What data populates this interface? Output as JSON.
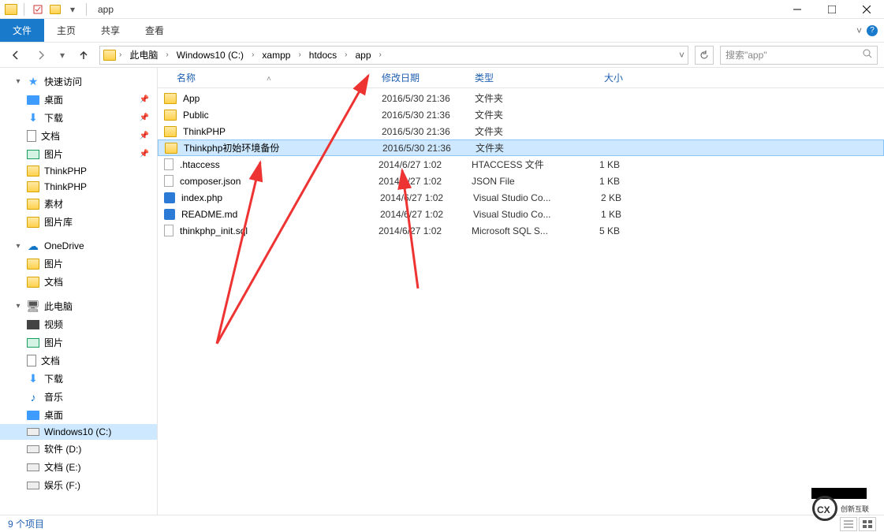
{
  "title": "app",
  "ribbon": {
    "file": "文件",
    "tabs": [
      "主页",
      "共享",
      "查看"
    ]
  },
  "breadcrumbs": [
    "此电脑",
    "Windows10 (C:)",
    "xampp",
    "htdocs",
    "app"
  ],
  "search_placeholder": "搜索\"app\"",
  "status_text": "9 个项目",
  "columns": {
    "name": "名称",
    "date": "修改日期",
    "type": "类型",
    "size": "大小"
  },
  "sidebar": {
    "quick": {
      "label": "快速访问",
      "items": [
        {
          "label": "桌面",
          "ico": "desktop",
          "pin": true
        },
        {
          "label": "下载",
          "ico": "download",
          "pin": true
        },
        {
          "label": "文档",
          "ico": "doc",
          "pin": true
        },
        {
          "label": "图片",
          "ico": "pic",
          "pin": true
        },
        {
          "label": "ThinkPHP",
          "ico": "folder"
        },
        {
          "label": "ThinkPHP",
          "ico": "folder"
        },
        {
          "label": "素材",
          "ico": "folder"
        },
        {
          "label": "图片库",
          "ico": "folder"
        }
      ]
    },
    "onedrive": {
      "label": "OneDrive",
      "items": [
        {
          "label": "图片",
          "ico": "folder"
        },
        {
          "label": "文档",
          "ico": "folder"
        }
      ]
    },
    "pc": {
      "label": "此电脑",
      "items": [
        {
          "label": "视频",
          "ico": "video"
        },
        {
          "label": "图片",
          "ico": "pic"
        },
        {
          "label": "文档",
          "ico": "doc"
        },
        {
          "label": "下载",
          "ico": "download"
        },
        {
          "label": "音乐",
          "ico": "music"
        },
        {
          "label": "桌面",
          "ico": "desktop"
        },
        {
          "label": "Windows10 (C:)",
          "ico": "drive",
          "selected": true
        },
        {
          "label": "软件 (D:)",
          "ico": "drive"
        },
        {
          "label": "文档 (E:)",
          "ico": "drive"
        },
        {
          "label": "娱乐 (F:)",
          "ico": "drive"
        }
      ]
    }
  },
  "files": [
    {
      "name": "App",
      "date": "2016/5/30 21:36",
      "type": "文件夹",
      "size": "",
      "ico": "folder"
    },
    {
      "name": "Public",
      "date": "2016/5/30 21:36",
      "type": "文件夹",
      "size": "",
      "ico": "folder"
    },
    {
      "name": "ThinkPHP",
      "date": "2016/5/30 21:36",
      "type": "文件夹",
      "size": "",
      "ico": "folder"
    },
    {
      "name": "Thinkphp初始环境备份",
      "date": "2016/5/30 21:36",
      "type": "文件夹",
      "size": "",
      "ico": "folder",
      "selected": true
    },
    {
      "name": ".htaccess",
      "date": "2014/6/27 1:02",
      "type": "HTACCESS 文件",
      "size": "1 KB",
      "ico": "file"
    },
    {
      "name": "composer.json",
      "date": "2014/6/27 1:02",
      "type": "JSON File",
      "size": "1 KB",
      "ico": "file"
    },
    {
      "name": "index.php",
      "date": "2014/6/27 1:02",
      "type": "Visual Studio Co...",
      "size": "2 KB",
      "ico": "vs"
    },
    {
      "name": "README.md",
      "date": "2014/6/27 1:02",
      "type": "Visual Studio Co...",
      "size": "1 KB",
      "ico": "vs"
    },
    {
      "name": "thinkphp_init.sql",
      "date": "2014/6/27 1:02",
      "type": "Microsoft SQL S...",
      "size": "5 KB",
      "ico": "sql"
    }
  ],
  "watermark": "创新互联"
}
